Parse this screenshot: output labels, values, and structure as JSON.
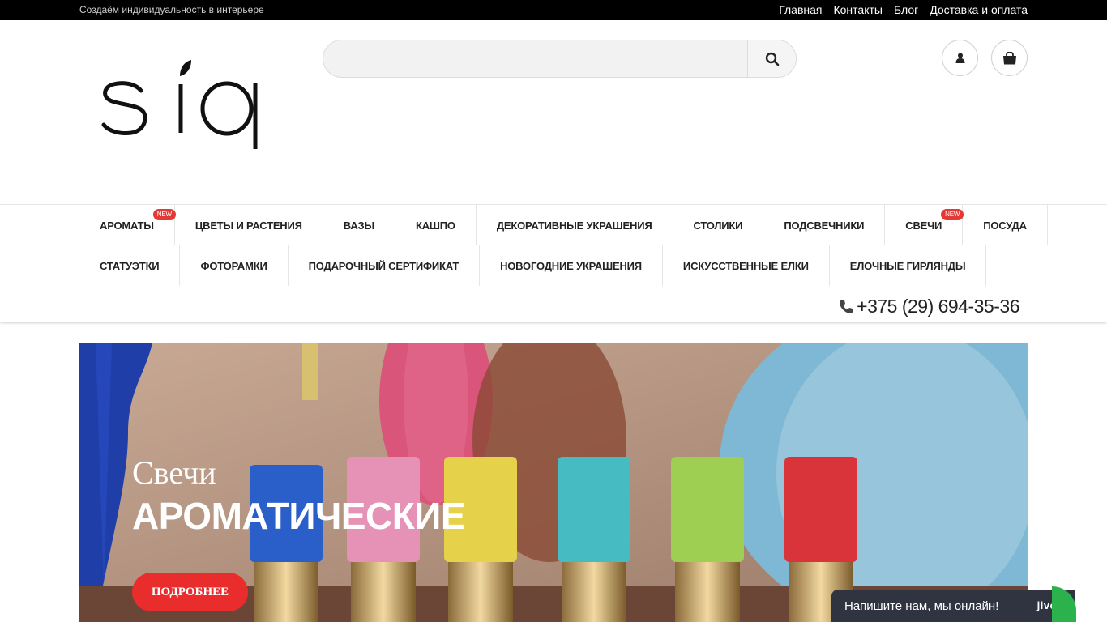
{
  "topbar": {
    "tagline": "Создаём индивидуальность в интерьере",
    "links": [
      "Главная",
      "Контакты",
      "Блог",
      "Доставка и оплата"
    ]
  },
  "header": {
    "logo_text": "sia",
    "search_placeholder": "",
    "icons": {
      "search": "search-icon",
      "user": "user-icon",
      "cart": "shopping-bag-icon"
    }
  },
  "nav": {
    "row1": [
      {
        "label": "АРОМАТЫ",
        "badge": "NEW"
      },
      {
        "label": "ЦВЕТЫ И РАСТЕНИЯ",
        "badge": ""
      },
      {
        "label": "ВАЗЫ",
        "badge": ""
      },
      {
        "label": "КАШПО",
        "badge": ""
      },
      {
        "label": "ДЕКОРАТИВНЫЕ УКРАШЕНИЯ",
        "badge": ""
      },
      {
        "label": "СТОЛИКИ",
        "badge": ""
      },
      {
        "label": "ПОДСВЕЧНИКИ",
        "badge": ""
      },
      {
        "label": "СВЕЧИ",
        "badge": "NEW"
      },
      {
        "label": "ПОСУДА",
        "badge": ""
      }
    ],
    "row2": [
      {
        "label": "СТАТУЭТКИ",
        "badge": ""
      },
      {
        "label": "ФОТОРАМКИ",
        "badge": ""
      },
      {
        "label": "ПОДАРОЧНЫЙ СЕРТИФИКАТ",
        "badge": ""
      },
      {
        "label": "НОВОГОДНИЕ УКРАШЕНИЯ",
        "badge": ""
      },
      {
        "label": "ИСКУССТВЕННЫЕ ЕЛКИ",
        "badge": ""
      },
      {
        "label": "ЕЛОЧНЫЕ ГИРЛЯНДЫ",
        "badge": ""
      }
    ],
    "phone": "+375 (29) 694-35-36"
  },
  "banner": {
    "subtitle": "Свечи",
    "title": "АРОМАТИЧЕСКИЕ",
    "button": "ПОДРОБНЕЕ"
  },
  "chat": {
    "text": "Напишите нам, мы онлайн!",
    "brand": "jivo"
  },
  "colors": {
    "accent": "#e92d2d",
    "badge": "#e53935",
    "topbar": "#000000",
    "chat": "#2f3440",
    "chat_green": "#2bb24c"
  }
}
